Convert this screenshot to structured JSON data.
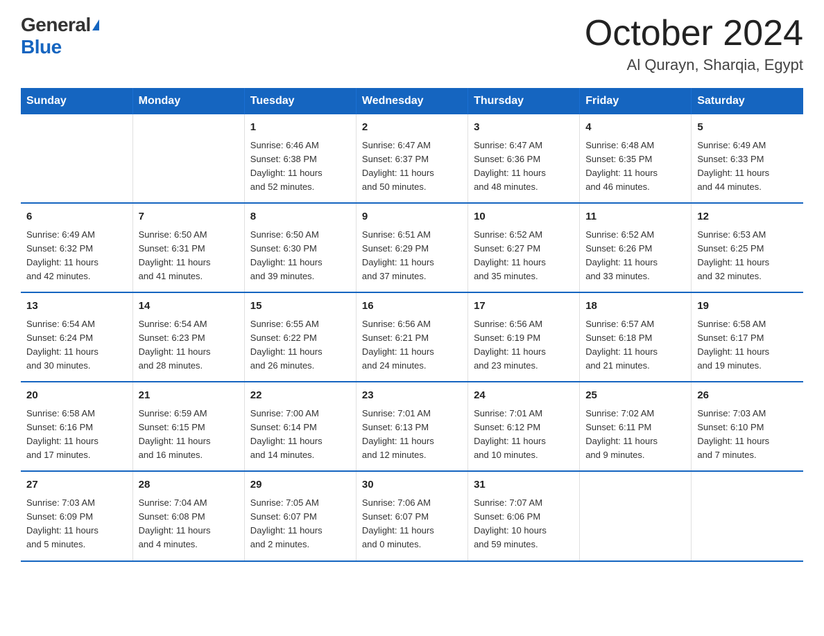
{
  "logo": {
    "general": "General",
    "blue": "Blue"
  },
  "title": "October 2024",
  "location": "Al Qurayn, Sharqia, Egypt",
  "weekdays": [
    "Sunday",
    "Monday",
    "Tuesday",
    "Wednesday",
    "Thursday",
    "Friday",
    "Saturday"
  ],
  "weeks": [
    [
      {
        "day": "",
        "info": ""
      },
      {
        "day": "",
        "info": ""
      },
      {
        "day": "1",
        "info": "Sunrise: 6:46 AM\nSunset: 6:38 PM\nDaylight: 11 hours\nand 52 minutes."
      },
      {
        "day": "2",
        "info": "Sunrise: 6:47 AM\nSunset: 6:37 PM\nDaylight: 11 hours\nand 50 minutes."
      },
      {
        "day": "3",
        "info": "Sunrise: 6:47 AM\nSunset: 6:36 PM\nDaylight: 11 hours\nand 48 minutes."
      },
      {
        "day": "4",
        "info": "Sunrise: 6:48 AM\nSunset: 6:35 PM\nDaylight: 11 hours\nand 46 minutes."
      },
      {
        "day": "5",
        "info": "Sunrise: 6:49 AM\nSunset: 6:33 PM\nDaylight: 11 hours\nand 44 minutes."
      }
    ],
    [
      {
        "day": "6",
        "info": "Sunrise: 6:49 AM\nSunset: 6:32 PM\nDaylight: 11 hours\nand 42 minutes."
      },
      {
        "day": "7",
        "info": "Sunrise: 6:50 AM\nSunset: 6:31 PM\nDaylight: 11 hours\nand 41 minutes."
      },
      {
        "day": "8",
        "info": "Sunrise: 6:50 AM\nSunset: 6:30 PM\nDaylight: 11 hours\nand 39 minutes."
      },
      {
        "day": "9",
        "info": "Sunrise: 6:51 AM\nSunset: 6:29 PM\nDaylight: 11 hours\nand 37 minutes."
      },
      {
        "day": "10",
        "info": "Sunrise: 6:52 AM\nSunset: 6:27 PM\nDaylight: 11 hours\nand 35 minutes."
      },
      {
        "day": "11",
        "info": "Sunrise: 6:52 AM\nSunset: 6:26 PM\nDaylight: 11 hours\nand 33 minutes."
      },
      {
        "day": "12",
        "info": "Sunrise: 6:53 AM\nSunset: 6:25 PM\nDaylight: 11 hours\nand 32 minutes."
      }
    ],
    [
      {
        "day": "13",
        "info": "Sunrise: 6:54 AM\nSunset: 6:24 PM\nDaylight: 11 hours\nand 30 minutes."
      },
      {
        "day": "14",
        "info": "Sunrise: 6:54 AM\nSunset: 6:23 PM\nDaylight: 11 hours\nand 28 minutes."
      },
      {
        "day": "15",
        "info": "Sunrise: 6:55 AM\nSunset: 6:22 PM\nDaylight: 11 hours\nand 26 minutes."
      },
      {
        "day": "16",
        "info": "Sunrise: 6:56 AM\nSunset: 6:21 PM\nDaylight: 11 hours\nand 24 minutes."
      },
      {
        "day": "17",
        "info": "Sunrise: 6:56 AM\nSunset: 6:19 PM\nDaylight: 11 hours\nand 23 minutes."
      },
      {
        "day": "18",
        "info": "Sunrise: 6:57 AM\nSunset: 6:18 PM\nDaylight: 11 hours\nand 21 minutes."
      },
      {
        "day": "19",
        "info": "Sunrise: 6:58 AM\nSunset: 6:17 PM\nDaylight: 11 hours\nand 19 minutes."
      }
    ],
    [
      {
        "day": "20",
        "info": "Sunrise: 6:58 AM\nSunset: 6:16 PM\nDaylight: 11 hours\nand 17 minutes."
      },
      {
        "day": "21",
        "info": "Sunrise: 6:59 AM\nSunset: 6:15 PM\nDaylight: 11 hours\nand 16 minutes."
      },
      {
        "day": "22",
        "info": "Sunrise: 7:00 AM\nSunset: 6:14 PM\nDaylight: 11 hours\nand 14 minutes."
      },
      {
        "day": "23",
        "info": "Sunrise: 7:01 AM\nSunset: 6:13 PM\nDaylight: 11 hours\nand 12 minutes."
      },
      {
        "day": "24",
        "info": "Sunrise: 7:01 AM\nSunset: 6:12 PM\nDaylight: 11 hours\nand 10 minutes."
      },
      {
        "day": "25",
        "info": "Sunrise: 7:02 AM\nSunset: 6:11 PM\nDaylight: 11 hours\nand 9 minutes."
      },
      {
        "day": "26",
        "info": "Sunrise: 7:03 AM\nSunset: 6:10 PM\nDaylight: 11 hours\nand 7 minutes."
      }
    ],
    [
      {
        "day": "27",
        "info": "Sunrise: 7:03 AM\nSunset: 6:09 PM\nDaylight: 11 hours\nand 5 minutes."
      },
      {
        "day": "28",
        "info": "Sunrise: 7:04 AM\nSunset: 6:08 PM\nDaylight: 11 hours\nand 4 minutes."
      },
      {
        "day": "29",
        "info": "Sunrise: 7:05 AM\nSunset: 6:07 PM\nDaylight: 11 hours\nand 2 minutes."
      },
      {
        "day": "30",
        "info": "Sunrise: 7:06 AM\nSunset: 6:07 PM\nDaylight: 11 hours\nand 0 minutes."
      },
      {
        "day": "31",
        "info": "Sunrise: 7:07 AM\nSunset: 6:06 PM\nDaylight: 10 hours\nand 59 minutes."
      },
      {
        "day": "",
        "info": ""
      },
      {
        "day": "",
        "info": ""
      }
    ]
  ]
}
